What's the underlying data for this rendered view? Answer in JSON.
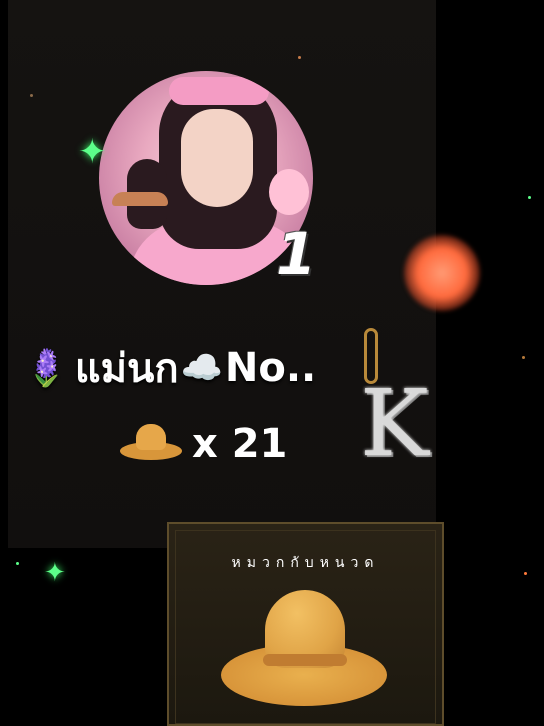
{
  "profile": {
    "rank": "1",
    "name": "แม่นก",
    "name_suffix": "No..",
    "flower_emoji": "🪻",
    "cloud_emoji": "☁️"
  },
  "gift": {
    "count_text": "x 21",
    "icon": "cowboy-hat-icon",
    "card_title": "หมวกกับหนวด"
  },
  "decor": {
    "pendant_letter": "K",
    "accent_orb_color": "#ff6a3d",
    "sparkle_color": "#5cff8a",
    "card_border_color": "#5e4d2b"
  }
}
